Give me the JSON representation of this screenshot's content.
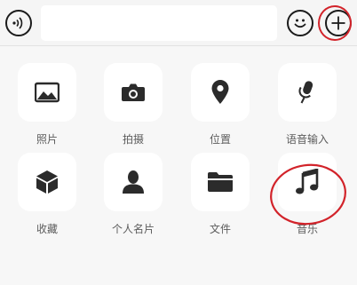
{
  "toolbar": {
    "voice_icon": "voice-wave-icon",
    "input_value": "",
    "emoji_icon": "smiley-icon",
    "plus_icon": "plus-icon"
  },
  "panel": {
    "items": [
      {
        "label": "照片",
        "icon": "photo-icon"
      },
      {
        "label": "拍摄",
        "icon": "camera-icon"
      },
      {
        "label": "位置",
        "icon": "location-pin-icon"
      },
      {
        "label": "语音输入",
        "icon": "microphone-icon"
      },
      {
        "label": "收藏",
        "icon": "cube-icon"
      },
      {
        "label": "个人名片",
        "icon": "person-icon"
      },
      {
        "label": "文件",
        "icon": "folder-icon"
      },
      {
        "label": "音乐",
        "icon": "music-note-icon"
      }
    ]
  },
  "annotation_color": "#d2232a",
  "icon_color": "#2b2b2b"
}
